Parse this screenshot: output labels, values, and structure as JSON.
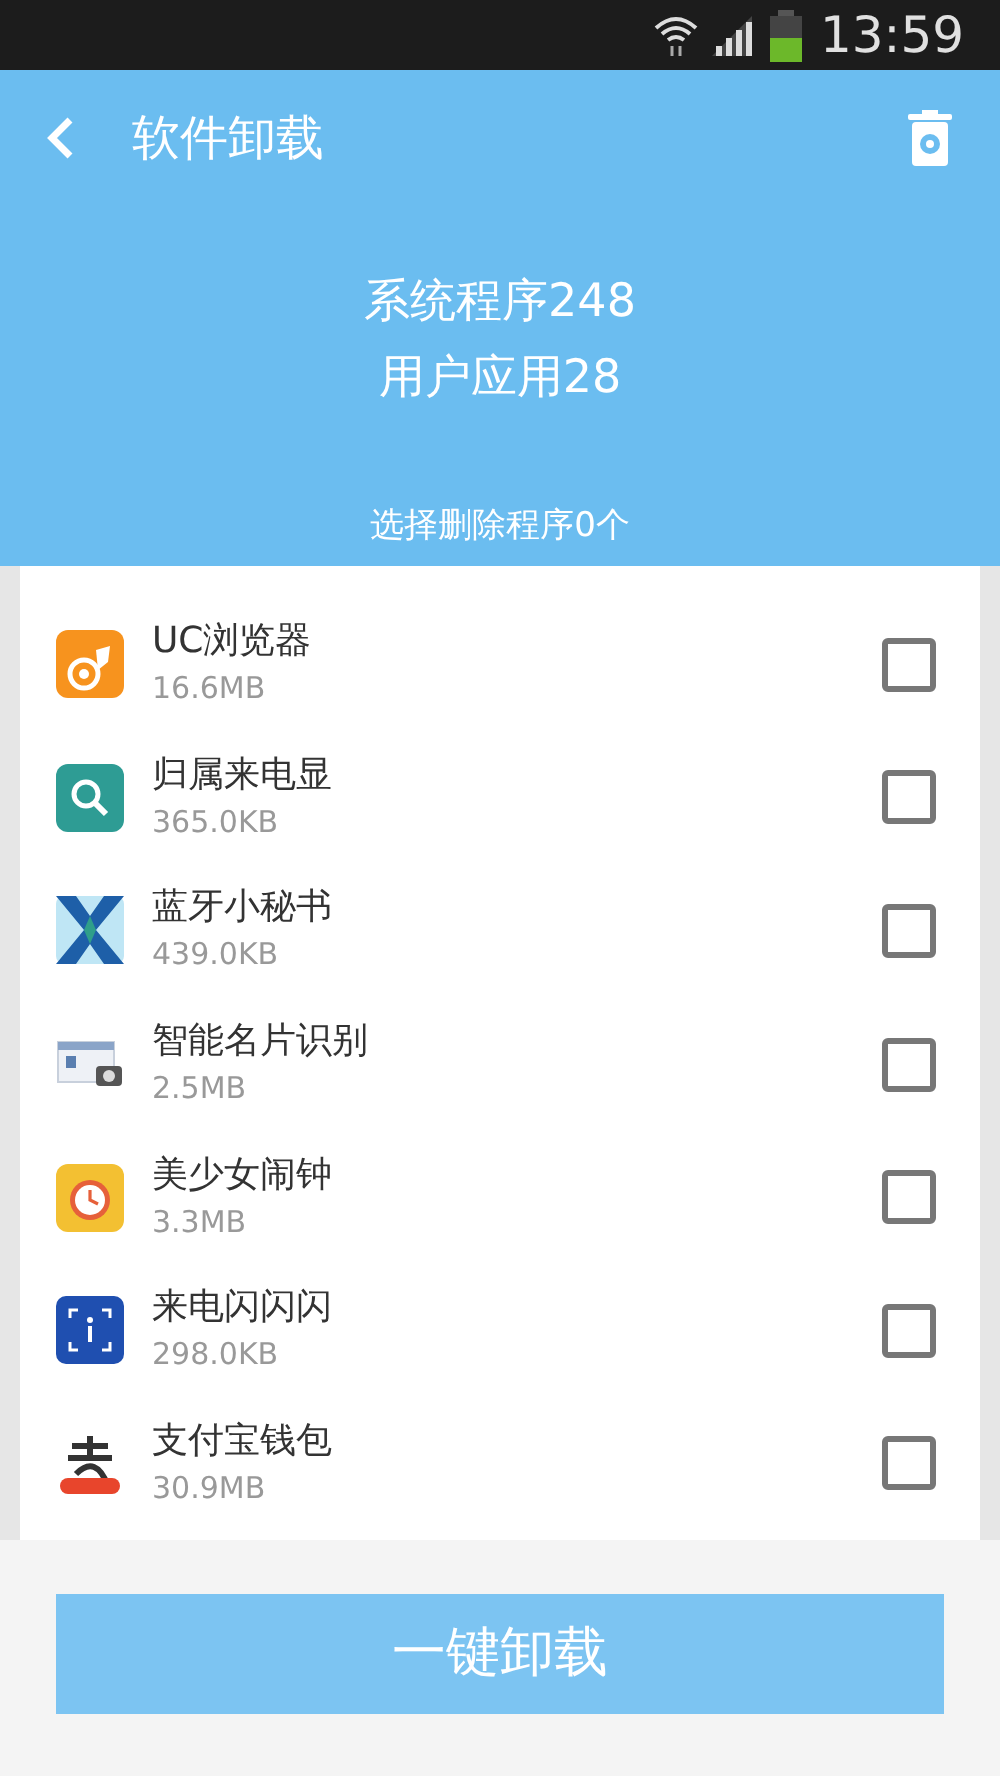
{
  "status_bar": {
    "time": "13:59"
  },
  "header": {
    "title": "软件卸载",
    "system_apps": "系统程序248",
    "user_apps": "用户应用28",
    "selected_count": "选择删除程序0个"
  },
  "apps": [
    {
      "name": "UC浏览器",
      "size": "16.6MB",
      "checked": false
    },
    {
      "name": "归属来电显",
      "size": "365.0KB",
      "checked": false
    },
    {
      "name": "蓝牙小秘书",
      "size": "439.0KB",
      "checked": false
    },
    {
      "name": "智能名片识别",
      "size": "2.5MB",
      "checked": false
    },
    {
      "name": "美少女闹钟",
      "size": "3.3MB",
      "checked": false
    },
    {
      "name": "来电闪闪闪",
      "size": "298.0KB",
      "checked": false
    },
    {
      "name": "支付宝钱包",
      "size": "30.9MB",
      "checked": false
    }
  ],
  "uninstall_button": "一键卸载"
}
